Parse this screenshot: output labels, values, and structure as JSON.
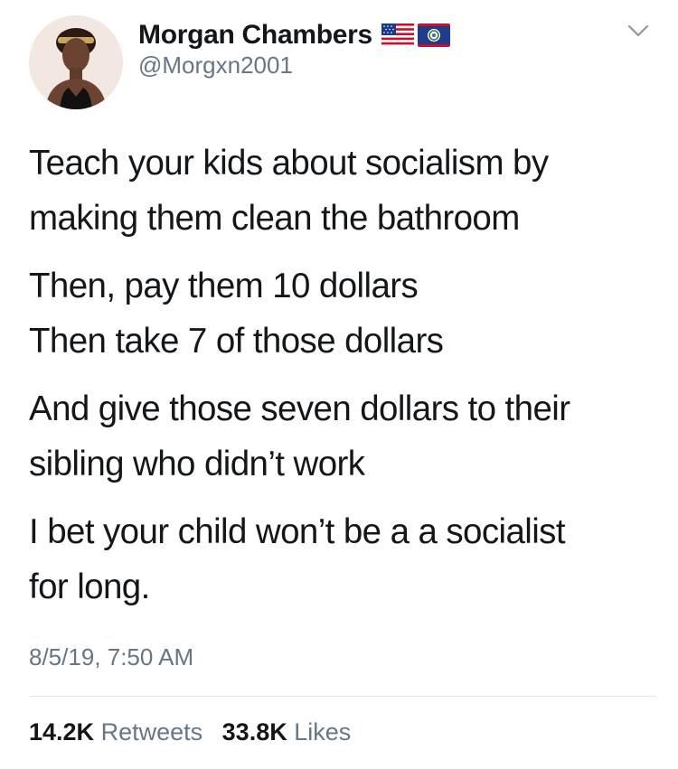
{
  "author": {
    "display_name": "Morgan Chambers",
    "handle": "@Morgxn2001",
    "flags": [
      "us-flag-icon",
      "belize-flag-icon"
    ]
  },
  "tweet": {
    "paragraphs": [
      [
        "Teach your kids about socialism by",
        "making them clean the bathroom"
      ],
      [
        "Then, pay them 10 dollars",
        "Then take 7 of those dollars"
      ],
      [
        "And give those seven dollars to their",
        "sibling who didn’t work"
      ],
      [
        "I bet your child won’t be a a socialist",
        "for long."
      ]
    ],
    "timestamp": "8/5/19, 7:50 AM"
  },
  "stats": {
    "retweets_count": "14.2K",
    "retweets_label": "Retweets",
    "likes_count": "33.8K",
    "likes_label": "Likes"
  },
  "colors": {
    "text": "#14171a",
    "secondary": "#657786",
    "divider": "#e1e8ed"
  }
}
